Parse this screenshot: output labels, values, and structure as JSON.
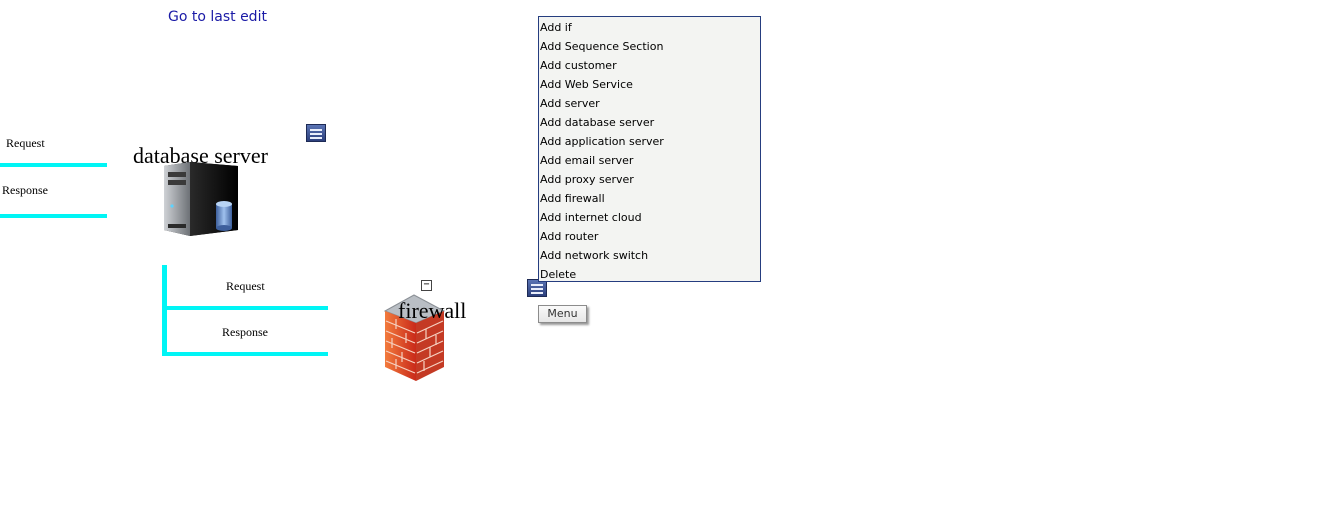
{
  "nav": {
    "go_last_edit": "Go to last edit"
  },
  "top_connector": {
    "request": "Request",
    "response": "Response"
  },
  "database_node": {
    "title": "database server",
    "icon": "database-server-icon"
  },
  "bottom_connector": {
    "request": "Request",
    "response": "Response"
  },
  "firewall_node": {
    "title": "firewall",
    "icon": "firewall-icon",
    "collapse": "−"
  },
  "context_menu": {
    "items": [
      "Add if",
      "Add Sequence Section",
      "Add customer",
      "Add Web Service",
      "Add server",
      "Add database server",
      "Add application server",
      "Add email server",
      "Add proxy server",
      "Add firewall",
      "Add internet cloud",
      "Add router",
      "Add network switch",
      "Delete"
    ]
  },
  "menu_button": "Menu",
  "colors": {
    "connector": "#00f5f5",
    "link": "#1a1aa6",
    "menu_border": "#253d7f"
  }
}
